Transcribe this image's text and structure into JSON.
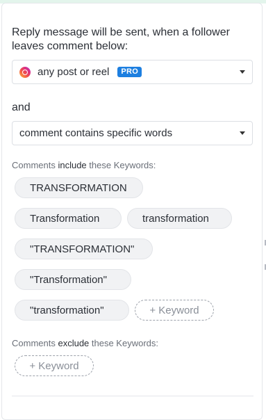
{
  "heading": "Reply message will be sent, when a follower leaves comment below:",
  "post_select": {
    "value": "any post or reel",
    "badge": "PRO",
    "icon": "instagram-icon"
  },
  "and_label": "and",
  "condition_select": {
    "value": "comment contains specific words"
  },
  "include_section": {
    "prefix": "Comments ",
    "keyword": "include",
    "suffix": " these Keywords:",
    "keywords": [
      "TRANSFORMATION",
      "Transformation",
      "transformation",
      "\"TRANSFORMATION\"",
      "\"Transformation\"",
      "\"transformation\""
    ],
    "add_label": "+ Keyword"
  },
  "exclude_section": {
    "prefix": "Comments ",
    "keyword": "exclude",
    "suffix": " these Keywords:",
    "keywords": [],
    "add_label": "+ Keyword"
  },
  "colors": {
    "accent": "#1d7fe0",
    "top_band": "#e3f5ec",
    "chip_bg": "#f1f2f4"
  }
}
